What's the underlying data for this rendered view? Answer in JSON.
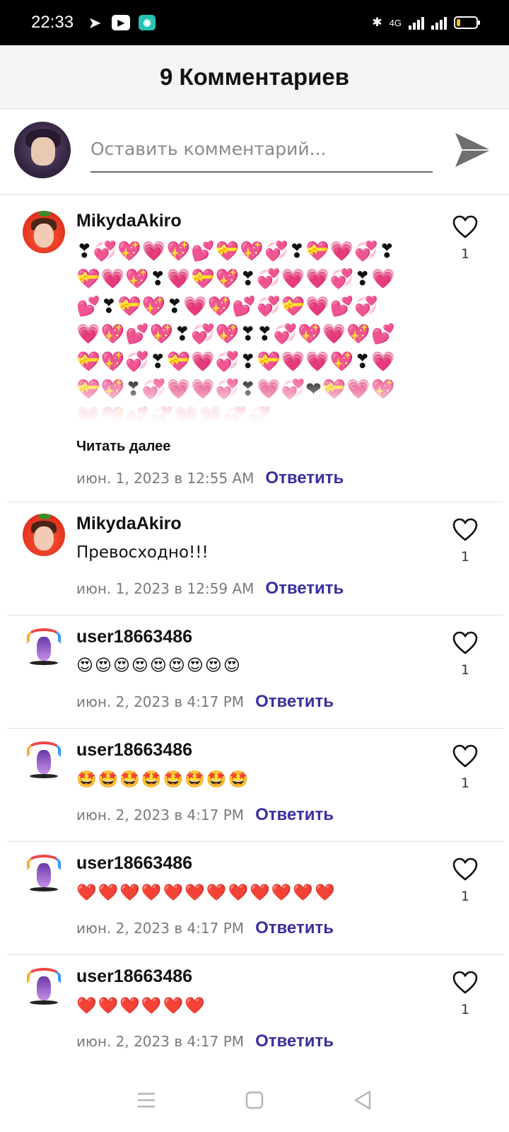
{
  "status_bar": {
    "time": "22:33",
    "apps": [
      "telegram-icon",
      "youtube-icon",
      "app-icon"
    ],
    "network": "4G",
    "battery_level": 0.15
  },
  "header": {
    "title": "9 Комментариев"
  },
  "composer": {
    "placeholder": "Оставить комментарий..."
  },
  "comments": [
    {
      "author": "MikydaAkiro",
      "text": "❣💞💖💗💖💕💝💖💞❣💝💗💞❣💝💗💖❣💗💝💖❣💞💗💗💞❣💗💕❣💝💖❣💗💖💕💞💝💗💕💞💗💖💕💖❣💞💖❣❣💞💖💗💖💕💝💖💞❣💝💗💞❣💝💗💗💖❣💗💝💖❣💞💗💗💞❣💗💞❤💝💗💖💗💖💕💞💗💗💞💞",
      "read_more": "Читать далее",
      "date": "июн. 1, 2023 в 12:55 AM",
      "reply": "Ответить",
      "likes": "1"
    },
    {
      "author": "MikydaAkiro",
      "text": "Превосходно!!!",
      "date": "июн. 1, 2023 в 12:59 AM",
      "reply": "Ответить",
      "likes": "1"
    },
    {
      "author": "user18663486",
      "text": "😍😍😍😍😍😍😍😍😍",
      "date": "июн. 2, 2023 в 4:17 PM",
      "reply": "Ответить",
      "likes": "1"
    },
    {
      "author": "user18663486",
      "text": "🤩🤩🤩🤩🤩🤩🤩🤩",
      "date": "июн. 2, 2023 в 4:17 PM",
      "reply": "Ответить",
      "likes": "1"
    },
    {
      "author": "user18663486",
      "text": "❤️❤️❤️❤️❤️❤️❤️❤️❤️❤️❤️❤️",
      "date": "июн. 2, 2023 в 4:17 PM",
      "reply": "Ответить",
      "likes": "1"
    },
    {
      "author": "user18663486",
      "text": "❤️❤️❤️❤️❤️❤️",
      "date": "июн. 2, 2023 в 4:17 PM",
      "reply": "Ответить",
      "likes": "1"
    }
  ],
  "navbar": {
    "items": [
      "menu-icon",
      "home-square-icon",
      "back-triangle-icon"
    ]
  }
}
